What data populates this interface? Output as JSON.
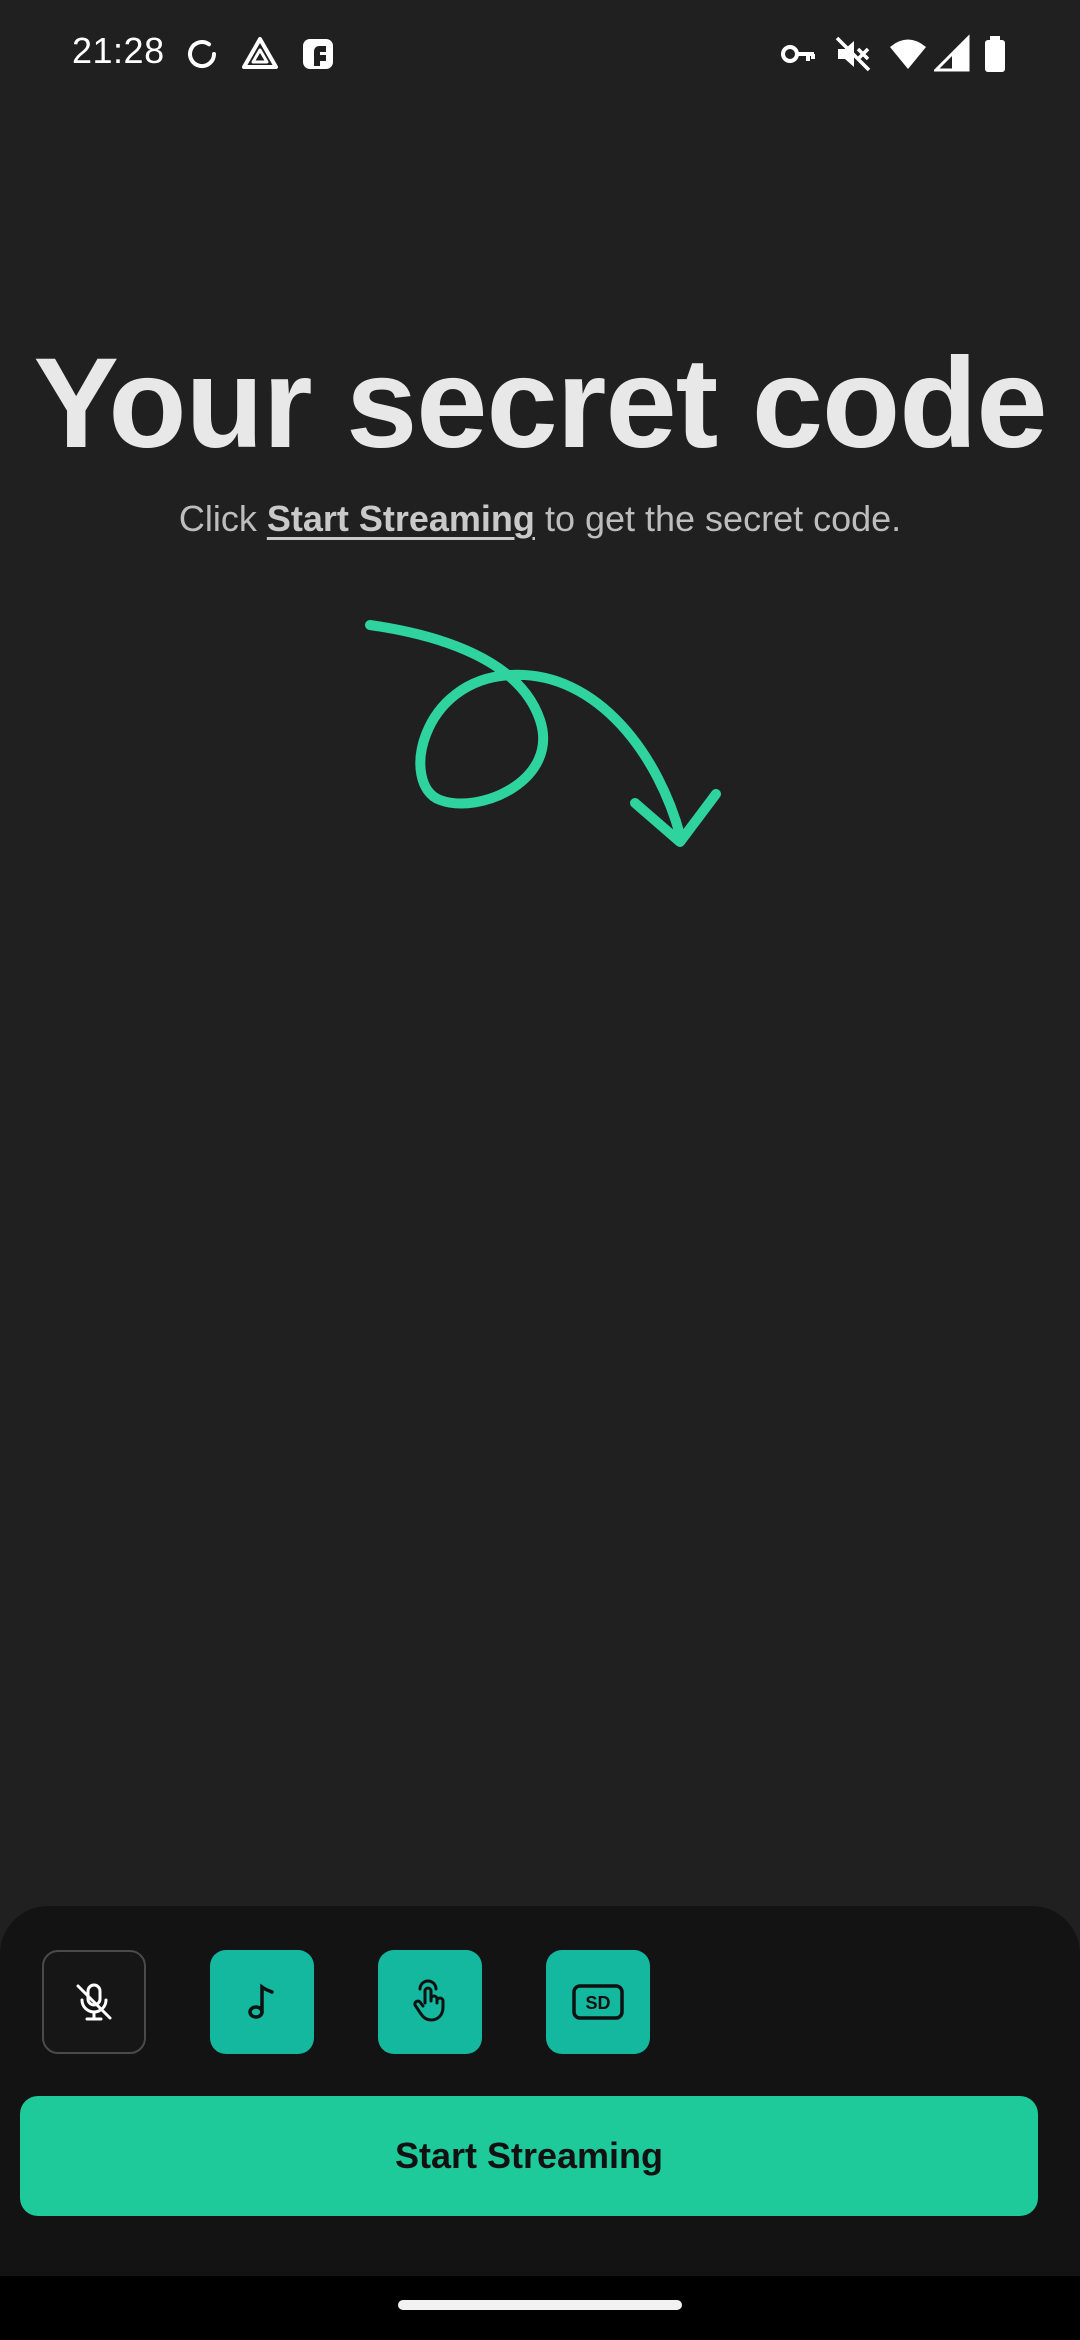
{
  "status_bar": {
    "time": "21:28",
    "left_icons": [
      "sync-icon",
      "drive-triangle-icon",
      "app-notification-icon"
    ],
    "right_icons": [
      "vpn-key-icon",
      "mute-icon",
      "wifi-icon",
      "cell-signal-icon",
      "battery-icon"
    ]
  },
  "main": {
    "title": "Your secret code",
    "subtitle_before": "Click",
    "subtitle_link": "Start Streaming",
    "subtitle_after": "to get the secret code.",
    "arrow_icon": "curly-arrow-icon"
  },
  "toolbar": {
    "buttons": [
      {
        "name": "mic-off-icon",
        "state": "off"
      },
      {
        "name": "music-note-icon",
        "state": "on"
      },
      {
        "name": "touch-icon",
        "state": "on"
      },
      {
        "name": "sd-quality-icon",
        "state": "on"
      }
    ]
  },
  "actions": {
    "start_label": "Start Streaming"
  },
  "colors": {
    "background": "#202020",
    "accent": "#1ec99a",
    "toggle_on": "#13b89e",
    "panel": "#131313"
  }
}
